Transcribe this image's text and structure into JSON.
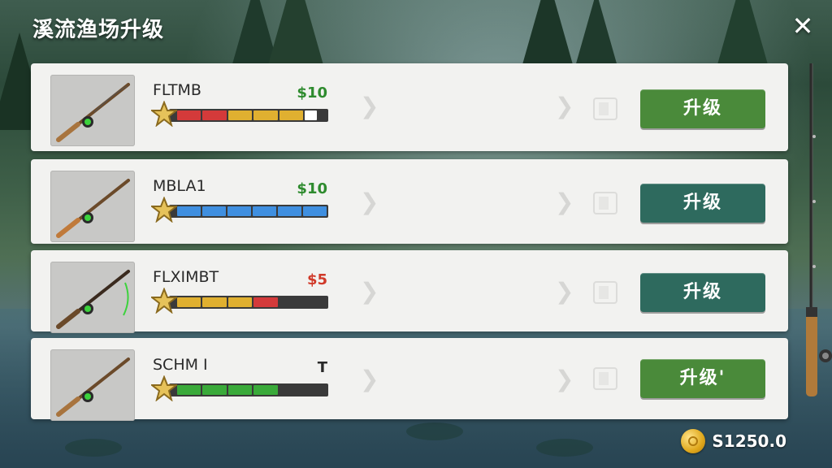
{
  "screen": {
    "title": "溪流渔场升级",
    "close_icon": "close-x-icon"
  },
  "rods": [
    {
      "name": "FLTMB",
      "price": "$10",
      "price_color": "#2e8b2e",
      "stat_level": 0.55,
      "segments": [
        "#d43a3a",
        "#d43a3a",
        "#e0b030",
        "#e0b030",
        "#e0b030",
        "#ffffff"
      ],
      "button_label": "升级",
      "button_color": "#4a8a3a"
    },
    {
      "name": "MBLA1",
      "price": "$10",
      "price_color": "#2e8b2e",
      "stat_level": 0.72,
      "segments": [
        "#3f8fe0",
        "#3f8fe0",
        "#3f8fe0",
        "#3f8fe0",
        "#3f8fe0",
        "#3f8fe0"
      ],
      "button_label": "升级",
      "button_color": "#2e6a5e"
    },
    {
      "name": "FLXIMBT",
      "price": "$5",
      "price_color": "#d03a2a",
      "stat_level": 0.5,
      "segments": [
        "#e0b030",
        "#e0b030",
        "#e0b030",
        "#d43a3a"
      ],
      "button_label": "升级",
      "button_color": "#2e6a5e"
    },
    {
      "name": "SCHM I",
      "price": "T",
      "price_color": "#2a2a2a",
      "stat_level": 0.45,
      "segments": [
        "#3aaa3a",
        "#3aaa3a",
        "#3aaa3a",
        "#3aaa3a"
      ],
      "button_label": "升级'",
      "button_color": "#4a8a3a"
    }
  ],
  "currency": {
    "amount": "S1250.0",
    "icon": "gold-coin-icon"
  }
}
